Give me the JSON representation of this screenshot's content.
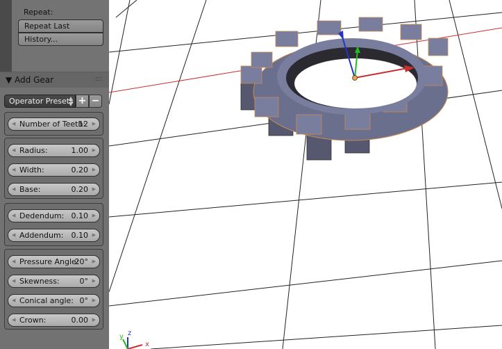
{
  "repeat": {
    "label": "Repeat:",
    "repeat_last": "Repeat Last",
    "history": "History..."
  },
  "operator": {
    "title": "Add Gear",
    "drag_handle": "::::",
    "presets": "Operator Presets",
    "add": "+",
    "remove": "−"
  },
  "fields": [
    {
      "label": "Number of Teeth:",
      "value": "12"
    },
    {
      "label": "Radius:",
      "value": "1.00"
    },
    {
      "label": "Width:",
      "value": "0.20"
    },
    {
      "label": "Base:",
      "value": "0.20"
    },
    {
      "label": "Dedendum:",
      "value": "0.10"
    },
    {
      "label": "Addendum:",
      "value": "0.10"
    },
    {
      "label": "Pressure Angle:",
      "value": "20°"
    },
    {
      "label": "Skewness:",
      "value": "0°"
    },
    {
      "label": "Conical angle:",
      "value": "0°"
    },
    {
      "label": "Crown:",
      "value": "0.00"
    }
  ],
  "axes": {
    "z": "z",
    "y": "y",
    "x": "x"
  },
  "colors": {
    "x_axis": "#c83030",
    "y_axis": "#22bb22",
    "z_axis": "#2233cc",
    "gear": "#7a7e9e"
  }
}
